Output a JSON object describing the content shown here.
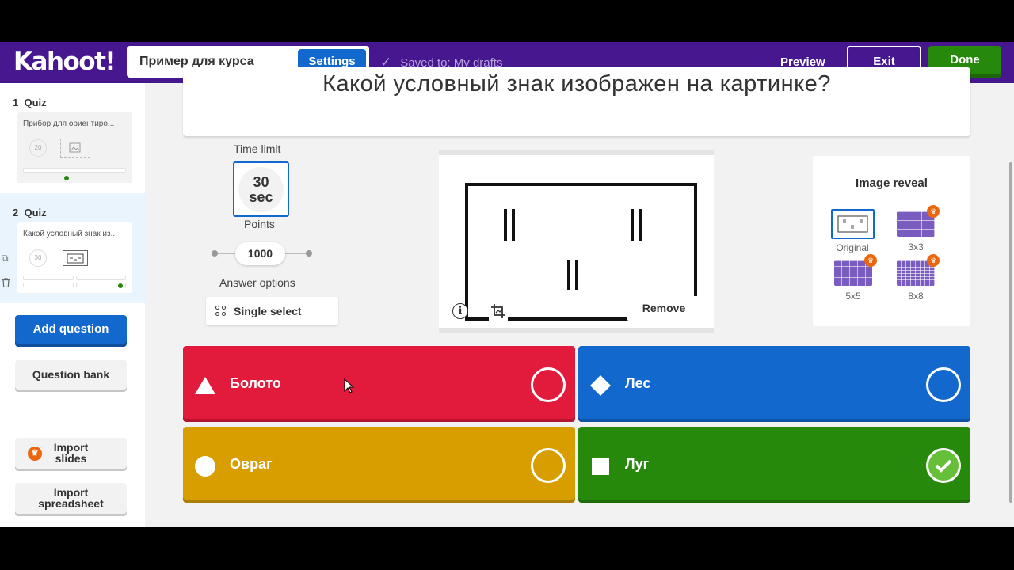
{
  "app": {
    "logo": "Kahoot!",
    "title": "Пример для курса",
    "settings_label": "Settings",
    "saved_text": "Saved to: My drafts",
    "preview_label": "Preview",
    "exit_label": "Exit",
    "done_label": "Done"
  },
  "sidebar": {
    "slides": [
      {
        "number": "1",
        "type": "Quiz",
        "text": "Прибор для ориентиро...",
        "timer": "20"
      },
      {
        "number": "2",
        "type": "Quiz",
        "text": "Какой условный знак из...",
        "timer": "30"
      }
    ],
    "add_question": "Add question",
    "question_bank": "Question bank",
    "import_slides_line1": "Import",
    "import_slides_line2": "slides",
    "import_sheet_line1": "Import",
    "import_sheet_line2": "spreadsheet"
  },
  "question": {
    "text": "Какой условный знак изображен на картинке?",
    "time_limit_label": "Time limit",
    "time_value": "30",
    "time_unit": "sec",
    "points_label": "Points",
    "points_value": "1000",
    "answer_options_label": "Answer options",
    "answer_type": "Single select",
    "remove_label": "Remove"
  },
  "image_reveal": {
    "title": "Image reveal",
    "options": [
      "Original",
      "3x3",
      "5x5",
      "8x8"
    ],
    "selected": "Original"
  },
  "answers": [
    {
      "text": "Болото",
      "shape": "triangle",
      "color": "#e21b3c",
      "correct": false
    },
    {
      "text": "Лес",
      "shape": "diamond",
      "color": "#1368ce",
      "correct": false
    },
    {
      "text": "Овраг",
      "shape": "circle",
      "color": "#d89e00",
      "correct": false
    },
    {
      "text": "Луг",
      "shape": "square",
      "color": "#26890c",
      "correct": true
    }
  ],
  "colors": {
    "topbar": "#46178f",
    "accent": "#1368ce",
    "done": "#26890c",
    "premium": "#eb670f"
  }
}
